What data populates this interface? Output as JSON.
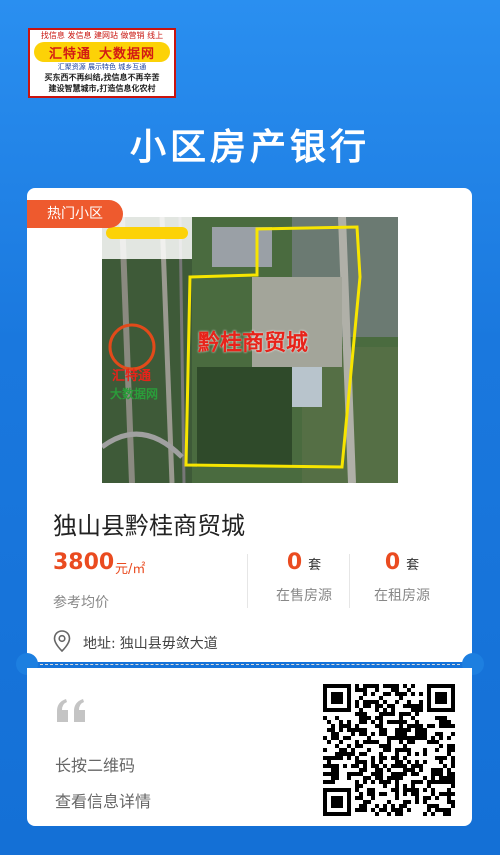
{
  "logo": {
    "top_line": "找信息 发信息 建网站 做营销 线上",
    "brand_left": "汇特通",
    "brand_right": "大数据网",
    "sub_line": "汇聚资源 展示特色 城乡互通",
    "slogan_1": "买东西不再纠结,找信息不再辛苦",
    "slogan_2": "建设智慧城市,打造信息化农村"
  },
  "page_title": "小区房产银行",
  "card": {
    "tag": "热门小区",
    "photo_label": "黔桂商贸城",
    "watermark_brand": "汇特通",
    "watermark_sub": "大数据网",
    "name": "独山县黔桂商贸城",
    "price_value": "3800",
    "price_unit": "元/㎡",
    "price_label": "参考均价",
    "for_sale_count": "0",
    "for_sale_unit": "套",
    "for_sale_label": "在售房源",
    "for_rent_count": "0",
    "for_rent_unit": "套",
    "for_rent_label": "在租房源",
    "address_label": "地址:",
    "address_value": "独山县毋敛大道"
  },
  "footer": {
    "hint_line_1": "长按二维码",
    "hint_line_2": "查看信息详情"
  },
  "colors": {
    "background": "#1d7fe0",
    "accent": "#ea4b20",
    "tag": "#ee5a2e"
  }
}
